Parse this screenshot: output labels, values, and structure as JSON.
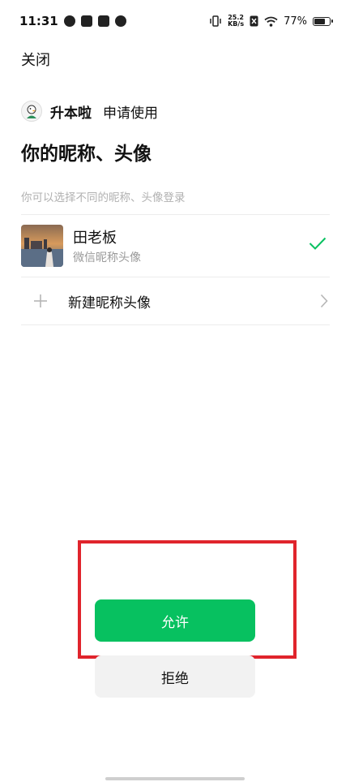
{
  "status_bar": {
    "time": "11:31",
    "net_speed_value": "25.2",
    "net_speed_unit": "KB/s",
    "battery_percent": "77%",
    "battery_level": 0.77,
    "icons": [
      "weibo-icon",
      "tiktok-icon",
      "calendar-icon",
      "mask-icon",
      "vibrate-icon",
      "sim-icon",
      "wifi-icon",
      "battery-icon"
    ]
  },
  "header": {
    "close_label": "关闭"
  },
  "app": {
    "name": "升本啦",
    "request_text": "申请使用"
  },
  "page": {
    "title": "你的昵称、头像",
    "hint": "你可以选择不同的昵称、头像登录"
  },
  "accounts": [
    {
      "name": "田老板",
      "subtitle": "微信昵称头像",
      "selected": true
    }
  ],
  "new_profile": {
    "label": "新建昵称头像"
  },
  "actions": {
    "allow_label": "允许",
    "reject_label": "拒绝"
  },
  "colors": {
    "primary": "#07c160",
    "highlight": "#e0242c",
    "secondary_button": "#f2f2f2"
  }
}
